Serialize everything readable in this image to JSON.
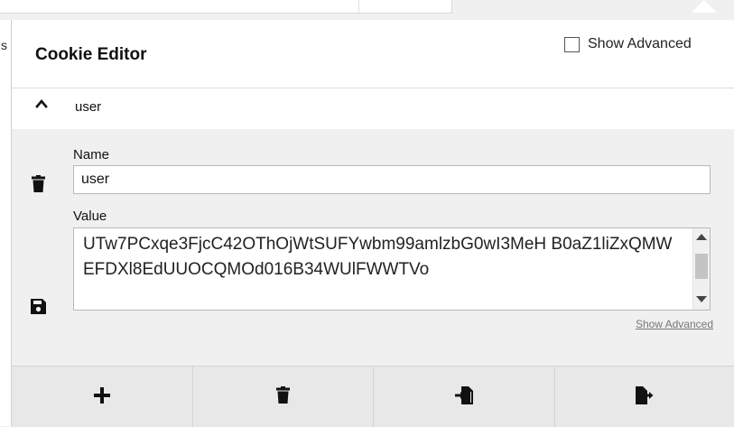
{
  "header": {
    "title": "Cookie Editor",
    "show_advanced_label": "Show Advanced",
    "show_advanced_checked": false
  },
  "background": {
    "left_edge_text": "s"
  },
  "cookie": {
    "name": "user",
    "expanded": true,
    "fields": {
      "name_label": "Name",
      "name_value": "user",
      "value_label": "Value",
      "value_text": "UTw7PCxqe3FjcC42OThOjWtSUFYwbm99amlzbG0wI3MeH B0aZ1liZxQMWEFDXl8EdUUOCQMOd016B34WUlFWWTVo"
    },
    "show_advanced_link": "Show Advanced"
  },
  "footer": {
    "buttons": [
      "add",
      "delete-all",
      "import",
      "export"
    ]
  },
  "icons": {
    "chevron": "chevron-up-icon",
    "delete": "trash-icon",
    "save": "save-icon",
    "add": "plus-icon",
    "import": "import-icon",
    "export": "export-icon"
  },
  "colors": {
    "panel_bg": "#f0f0f0",
    "header_bg": "#ffffff",
    "footer_bg": "#e8e8e8",
    "link": "#777777"
  }
}
